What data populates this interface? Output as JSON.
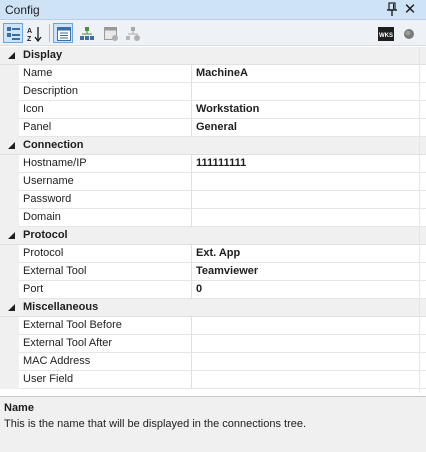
{
  "window": {
    "title": "Config",
    "pin_glyph": "pin-icon",
    "close_glyph": "✕"
  },
  "toolbar": {
    "buttons": [
      {
        "name": "categorized-view-button",
        "icon": "categorized-icon",
        "active": true
      },
      {
        "name": "alphabetical-sort-button",
        "icon": "sort-az-icon",
        "active": false
      },
      {
        "name": "properties-view-button",
        "icon": "properties-icon",
        "active": true
      },
      {
        "name": "inheritance-view-button",
        "icon": "inheritance-icon",
        "active": false
      },
      {
        "name": "default-properties-button",
        "icon": "default-properties-icon",
        "active": false
      },
      {
        "name": "default-inheritance-button",
        "icon": "default-inheritance-icon",
        "active": false
      }
    ],
    "right_buttons": [
      {
        "name": "host-status-button",
        "icon": "wks-icon",
        "label": "WKS"
      },
      {
        "name": "connection-status-button",
        "icon": "status-dot-icon"
      }
    ]
  },
  "grid": {
    "categories": [
      {
        "label": "Display",
        "properties": [
          {
            "name": "Name",
            "value": "MachineA"
          },
          {
            "name": "Description",
            "value": ""
          },
          {
            "name": "Icon",
            "value": "Workstation"
          },
          {
            "name": "Panel",
            "value": "General"
          }
        ]
      },
      {
        "label": "Connection",
        "properties": [
          {
            "name": "Hostname/IP",
            "value": "111111111"
          },
          {
            "name": "Username",
            "value": ""
          },
          {
            "name": "Password",
            "value": ""
          },
          {
            "name": "Domain",
            "value": ""
          }
        ]
      },
      {
        "label": "Protocol",
        "properties": [
          {
            "name": "Protocol",
            "value": "Ext. App"
          },
          {
            "name": "External Tool",
            "value": "Teamviewer"
          },
          {
            "name": "Port",
            "value": "0"
          }
        ]
      },
      {
        "label": "Miscellaneous",
        "properties": [
          {
            "name": "External Tool Before",
            "value": ""
          },
          {
            "name": "External Tool After",
            "value": ""
          },
          {
            "name": "MAC Address",
            "value": ""
          },
          {
            "name": "User Field",
            "value": ""
          }
        ]
      }
    ]
  },
  "help": {
    "title": "Name",
    "description": "This is the name that will be displayed in the connections tree."
  },
  "colors": {
    "titlebar": "#cfe3f7",
    "active_button": "#cde4fb",
    "category_bg": "#f0f0f0"
  }
}
